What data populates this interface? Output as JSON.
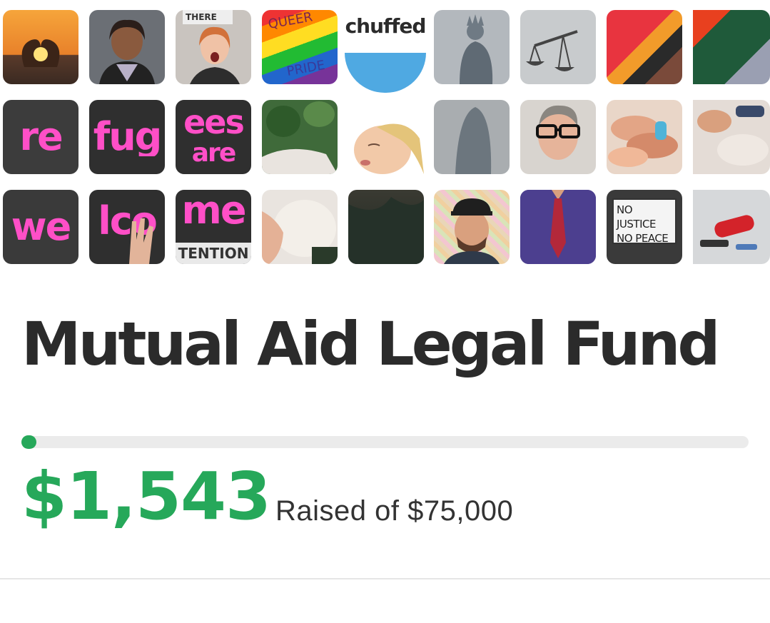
{
  "collage": {
    "logo_text": "chuffed",
    "sign_words": [
      "re",
      "fug",
      "ees",
      "are",
      "we",
      "lco",
      "me"
    ],
    "sign_small_left": "THERE",
    "sign_detention": "TENTION",
    "sign_queer": "QUEER",
    "sign_pride": "PRIDE",
    "protest_sign_line1": "NO JUSTICE",
    "protest_sign_line2": "NO PEACE"
  },
  "campaign": {
    "title": "Mutual Aid Legal Fund",
    "raised": "$1,543",
    "raised_caption": "Raised of $75,000",
    "progress_fraction": 0.0206
  },
  "colors": {
    "accent_green": "#26a85a",
    "logo_blue": "#4fa9e2",
    "sign_pink": "#ff4fc7"
  }
}
